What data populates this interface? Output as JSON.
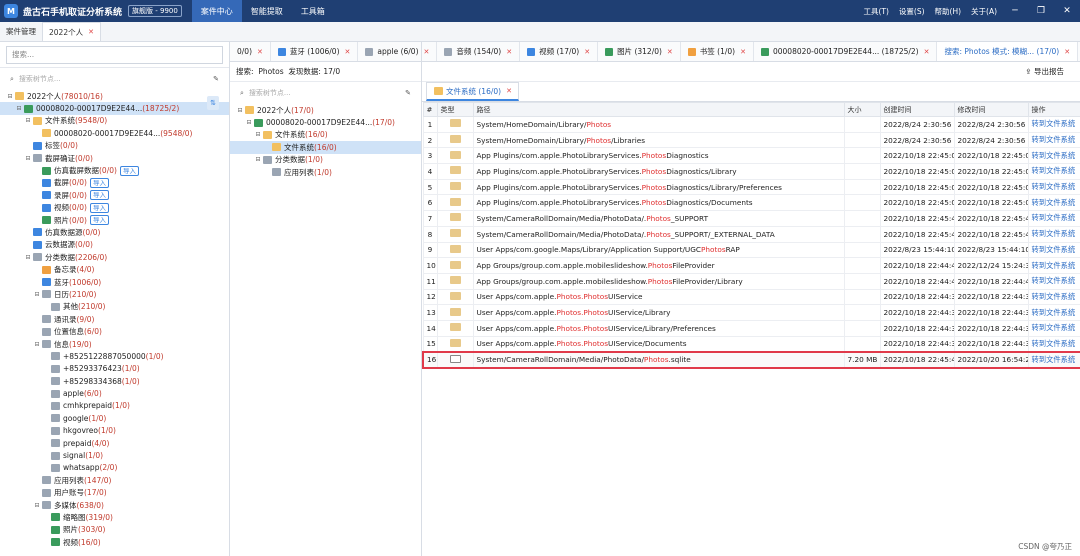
{
  "app": {
    "title": "盘古石手机取证分析系统",
    "version": "旗舰版 - 9900",
    "logo": "M"
  },
  "menus": [
    "案件中心",
    "智能提取",
    "工具箱"
  ],
  "right_menus": [
    "工具(T)",
    "设置(S)",
    "帮助(H)",
    "关于(A)"
  ],
  "page_tabs": [
    {
      "label": "案件管理"
    },
    {
      "label": "2022个人"
    }
  ],
  "left": {
    "search_placeholder": "搜索...",
    "node_search": "搜索树节点...",
    "tree": [
      {
        "d": 0,
        "icon": "fold",
        "pre": "2022个人",
        "num": "(78010/16)"
      },
      {
        "d": 1,
        "icon": "green",
        "pre": "00008020-00017D9E2E44...",
        "num": "(18725/2)",
        "sel": true
      },
      {
        "d": 2,
        "icon": "fold",
        "pre": "文件系统",
        "num": "(9548/0)"
      },
      {
        "d": 3,
        "icon": "fold",
        "pre": "00008020-00017D9E2E44...",
        "num": "(9548/0)"
      },
      {
        "d": 2,
        "icon": "blue",
        "pre": "标签",
        "num": "(0/0)"
      },
      {
        "d": 2,
        "icon": "gray",
        "pre": "截屏确证",
        "num": "(0/0)"
      },
      {
        "d": 3,
        "icon": "green",
        "pre": "仿真截屏数据",
        "num": "(0/0)",
        "imp": "导入"
      },
      {
        "d": 3,
        "icon": "blue",
        "pre": "截屏",
        "num": "(0/0)",
        "imp": "导入"
      },
      {
        "d": 3,
        "icon": "blue",
        "pre": "录屏",
        "num": "(0/0)",
        "imp": "导入"
      },
      {
        "d": 3,
        "icon": "blue",
        "pre": "视频",
        "num": "(0/0)",
        "imp": "导入"
      },
      {
        "d": 3,
        "icon": "green",
        "pre": "照片",
        "num": "(0/0)",
        "imp": "导入"
      },
      {
        "d": 2,
        "icon": "blue",
        "pre": "仿真数据源",
        "num": "(0/0)"
      },
      {
        "d": 2,
        "icon": "blue",
        "pre": "云数据源",
        "num": "(0/0)"
      },
      {
        "d": 2,
        "icon": "gray",
        "pre": "分类数据",
        "num": "(2206/0)"
      },
      {
        "d": 3,
        "icon": "orange",
        "pre": "备忘录",
        "num": "(4/0)"
      },
      {
        "d": 3,
        "icon": "blue",
        "pre": "蓝牙",
        "num": "(1006/0)"
      },
      {
        "d": 3,
        "icon": "gray",
        "pre": "日历",
        "num": "(210/0)"
      },
      {
        "d": 4,
        "icon": "gray",
        "pre": "其他",
        "num": "(210/0)"
      },
      {
        "d": 3,
        "icon": "gray",
        "pre": "通讯录",
        "num": "(9/0)"
      },
      {
        "d": 3,
        "icon": "gray",
        "pre": "位置信息",
        "num": "(6/0)"
      },
      {
        "d": 3,
        "icon": "gray",
        "pre": "信息",
        "num": "(19/0)"
      },
      {
        "d": 4,
        "icon": "gray",
        "pre": "+8525122887050000",
        "num": "(1/0)"
      },
      {
        "d": 4,
        "icon": "gray",
        "pre": "+85293376423",
        "num": "(1/0)"
      },
      {
        "d": 4,
        "icon": "gray",
        "pre": "+85298334368",
        "num": "(1/0)"
      },
      {
        "d": 4,
        "icon": "gray",
        "pre": "apple",
        "num": "(6/0)"
      },
      {
        "d": 4,
        "icon": "gray",
        "pre": "cmhkprepaid",
        "num": "(1/0)"
      },
      {
        "d": 4,
        "icon": "gray",
        "pre": "google",
        "num": "(1/0)"
      },
      {
        "d": 4,
        "icon": "gray",
        "pre": "hkgovreo",
        "num": "(1/0)"
      },
      {
        "d": 4,
        "icon": "gray",
        "pre": "prepaid",
        "num": "(4/0)"
      },
      {
        "d": 4,
        "icon": "gray",
        "pre": "signal",
        "num": "(1/0)"
      },
      {
        "d": 4,
        "icon": "gray",
        "pre": "whatsapp",
        "num": "(2/0)"
      },
      {
        "d": 3,
        "icon": "gray",
        "pre": "应用列表",
        "num": "(147/0)"
      },
      {
        "d": 3,
        "icon": "gray",
        "pre": "用户账号",
        "num": "(17/0)"
      },
      {
        "d": 3,
        "icon": "gray",
        "pre": "多媒体",
        "num": "(638/0)"
      },
      {
        "d": 4,
        "icon": "green",
        "pre": "缩略图",
        "num": "(319/0)"
      },
      {
        "d": 4,
        "icon": "green",
        "pre": "照片",
        "num": "(303/0)"
      },
      {
        "d": 4,
        "icon": "green",
        "pre": "视频",
        "num": "(16/0)"
      }
    ]
  },
  "subtabs": [
    {
      "label": "0/0)",
      "icon": ""
    },
    {
      "label": "蓝牙 (1006/0)",
      "icon": "blue"
    },
    {
      "label": "apple (6/0)",
      "icon": "gray"
    },
    {
      "label": "音频 (154/0)",
      "icon": "gray"
    },
    {
      "label": "视频 (17/0)",
      "icon": "blue"
    },
    {
      "label": "图片 (312/0)",
      "icon": "green"
    },
    {
      "label": "书签 (1/0)",
      "icon": "orange"
    },
    {
      "label": "00008020-00017D9E2E44... (18725/2)",
      "icon": "green"
    },
    {
      "label": "搜索: Photos 模式: 模糊... (17/0)",
      "icon": "",
      "active": true
    }
  ],
  "searchinfo": {
    "label": "搜索:",
    "keyword": "Photos",
    "found": "发现数据: 17/0",
    "export": "导出报告"
  },
  "middle": {
    "node_search": "搜索树节点...",
    "tree": [
      {
        "d": 0,
        "icon": "fold",
        "pre": "2022个人",
        "num": "(17/0)"
      },
      {
        "d": 1,
        "icon": "green",
        "pre": "00008020-00017D9E2E44...",
        "num": "(17/0)"
      },
      {
        "d": 2,
        "icon": "fold",
        "pre": "文件系统",
        "num": "(16/0)"
      },
      {
        "d": 3,
        "icon": "fold",
        "pre": "文件系统",
        "num": "(16/0)",
        "sel": true
      },
      {
        "d": 2,
        "icon": "gray",
        "pre": "分类数据",
        "num": "(1/0)"
      },
      {
        "d": 3,
        "icon": "gray",
        "pre": "应用列表",
        "num": "(1/0)"
      }
    ]
  },
  "file_tab": "文件系统 (16/0)",
  "table": {
    "headers": [
      "#",
      "类型",
      "路径",
      "大小",
      "创建时间",
      "修改时间",
      "操作"
    ],
    "rows": [
      {
        "n": "1",
        "a": "System/HomeDomain/Library/",
        "h": "Photos",
        "b": "",
        "size": "",
        "c": "2022/8/24 2:30:56",
        "m": "2022/8/24 2:30:56"
      },
      {
        "n": "2",
        "a": "System/HomeDomain/Library/",
        "h": "Photos",
        "b": "/Libraries",
        "size": "",
        "c": "2022/8/24 2:30:56",
        "m": "2022/8/24 2:30:56"
      },
      {
        "n": "3",
        "a": "App Plugins/com.apple.PhotoLibraryServices.",
        "h": "Photos",
        "b": "Diagnostics",
        "size": "",
        "c": "2022/10/18 22:45:07",
        "m": "2022/10/18 22:45:07"
      },
      {
        "n": "4",
        "a": "App Plugins/com.apple.PhotoLibraryServices.",
        "h": "Photos",
        "b": "Diagnostics/Library",
        "size": "",
        "c": "2022/10/18 22:45:07",
        "m": "2022/10/18 22:45:07"
      },
      {
        "n": "5",
        "a": "App Plugins/com.apple.PhotoLibraryServices.",
        "h": "Photos",
        "b": "Diagnostics/Library/Preferences",
        "size": "",
        "c": "2022/10/18 22:45:07",
        "m": "2022/10/18 22:45:07"
      },
      {
        "n": "6",
        "a": "App Plugins/com.apple.PhotoLibraryServices.",
        "h": "Photos",
        "b": "Diagnostics/Documents",
        "size": "",
        "c": "2022/10/18 22:45:07",
        "m": "2022/10/18 22:45:07"
      },
      {
        "n": "7",
        "a": "System/CameraRollDomain/Media/PhotoData/.",
        "h": "Photos",
        "b": "_SUPPORT",
        "size": "",
        "c": "2022/10/18 22:45:47",
        "m": "2022/10/18 22:45:47"
      },
      {
        "n": "8",
        "a": "System/CameraRollDomain/Media/PhotoData/.",
        "h": "Photos",
        "b": "_SUPPORT/_EXTERNAL_DATA",
        "size": "",
        "c": "2022/10/18 22:45:47",
        "m": "2022/10/18 22:45:47"
      },
      {
        "n": "9",
        "a": "User Apps/com.google.Maps/Library/Application Support/UGC",
        "h": "Photos",
        "b": "RAP",
        "size": "",
        "c": "2022/8/23 15:44:10",
        "m": "2022/8/23 15:44:10"
      },
      {
        "n": "10",
        "a": "App Groups/group.com.apple.mobileslideshow.",
        "h": "Photos",
        "b": "FileProvider",
        "size": "",
        "c": "2022/10/18 22:44:46",
        "m": "2022/12/24 15:24:37"
      },
      {
        "n": "11",
        "a": "App Groups/group.com.apple.mobileslideshow.",
        "h": "Photos",
        "b": "FileProvider/Library",
        "size": "",
        "c": "2022/10/18 22:44:46",
        "m": "2022/10/18 22:44:46"
      },
      {
        "n": "12",
        "a": "User Apps/com.apple.",
        "h": "Photos.Photos",
        "b": "UIService",
        "size": "",
        "c": "2022/10/18 22:44:39",
        "m": "2022/10/18 22:44:39"
      },
      {
        "n": "13",
        "a": "User Apps/com.apple.",
        "h": "Photos.Photos",
        "b": "UIService/Library",
        "size": "",
        "c": "2022/10/18 22:44:39",
        "m": "2022/10/18 22:44:39"
      },
      {
        "n": "14",
        "a": "User Apps/com.apple.",
        "h": "Photos.Photos",
        "b": "UIService/Library/Preferences",
        "size": "",
        "c": "2022/10/18 22:44:39",
        "m": "2022/10/18 22:44:39"
      },
      {
        "n": "15",
        "a": "User Apps/com.apple.",
        "h": "Photos.Photos",
        "b": "UIService/Documents",
        "size": "",
        "c": "2022/10/18 22:44:39",
        "m": "2022/10/18 22:44:39"
      },
      {
        "n": "16",
        "a": "System/CameraRollDomain/Media/PhotoData/",
        "h": "Photos",
        "b": ".sqlite",
        "size": "7.20 MB",
        "c": "2022/10/18 22:45:47",
        "m": "2022/10/20 16:54:28",
        "file": true,
        "highlight": true
      }
    ],
    "action": "转到文件系统"
  },
  "watermark": "CSDN @夸乃正"
}
